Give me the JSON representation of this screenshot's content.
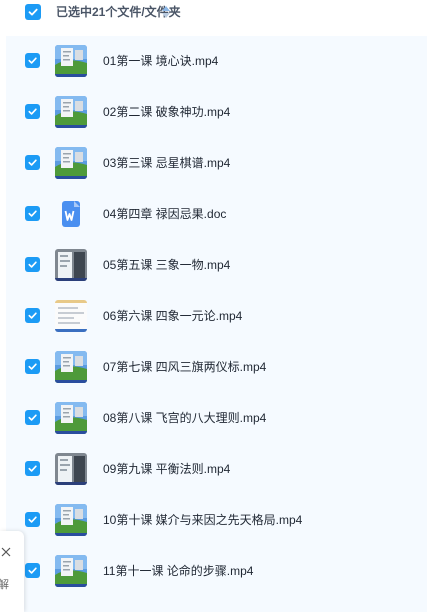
{
  "header": {
    "selection_text": "已选中21个文件/文件夹",
    "select_all_checked": true,
    "sort_icon": "sort-updown-icon"
  },
  "colors": {
    "accent": "#1c9bf5",
    "list_bg": "#f5faff",
    "text": "#1f2733"
  },
  "files": [
    {
      "name": "01第一课 境心诀.mp4",
      "thumb": "video",
      "checked": true
    },
    {
      "name": "02第二课 破象神功.mp4",
      "thumb": "video",
      "checked": true
    },
    {
      "name": "03第三课 忌星棋谱.mp4",
      "thumb": "video",
      "checked": true
    },
    {
      "name": "04第四章 禄因忌果.doc",
      "thumb": "doc",
      "checked": true
    },
    {
      "name": "05第五课 三象一物.mp4",
      "thumb": "video-dark",
      "checked": true
    },
    {
      "name": "06第六课 四象一元论.mp4",
      "thumb": "video-doc",
      "checked": true
    },
    {
      "name": "07第七课 四风三旗两仪标.mp4",
      "thumb": "video",
      "checked": true
    },
    {
      "name": "08第八课 飞宫的八大理则.mp4",
      "thumb": "video",
      "checked": true
    },
    {
      "name": "09第九课 平衡法则.mp4",
      "thumb": "video-dark",
      "checked": true
    },
    {
      "name": "10第十课 媒介与来因之先天格局.mp4",
      "thumb": "video",
      "checked": true
    },
    {
      "name": "11第十一课 论命的步骤.mp4",
      "thumb": "video",
      "checked": true
    }
  ],
  "side_panel": {
    "close_icon": "close-icon",
    "label": "解"
  }
}
